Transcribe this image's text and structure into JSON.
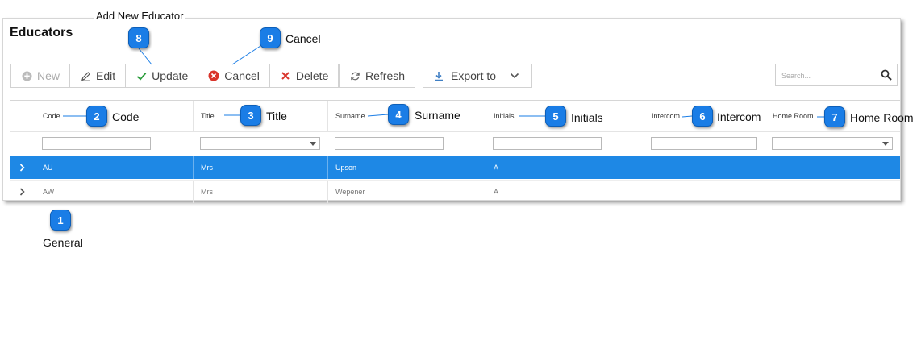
{
  "panel": {
    "title": "Educators"
  },
  "toolbar": {
    "new_label": "New",
    "edit_label": "Edit",
    "update_label": "Update",
    "cancel_label": "Cancel",
    "delete_label": "Delete",
    "refresh_label": "Refresh",
    "export_label": "Export to"
  },
  "search": {
    "placeholder": "Search..."
  },
  "grid": {
    "columns": [
      "Code",
      "Title",
      "Surname",
      "Initials",
      "Intercom",
      "Home Room"
    ],
    "rows": [
      {
        "code": "AU",
        "title": "Mrs",
        "surname": "Upson",
        "initials": "A",
        "intercom": "",
        "home_room": "",
        "selected": true
      },
      {
        "code": "AW",
        "title": "Mrs",
        "surname": "Wepener",
        "initials": "A",
        "intercom": "",
        "home_room": "",
        "selected": false
      }
    ]
  },
  "callouts": [
    {
      "number": "1",
      "label": "General"
    },
    {
      "number": "2",
      "label": "Code"
    },
    {
      "number": "3",
      "label": "Title"
    },
    {
      "number": "4",
      "label": "Surname"
    },
    {
      "number": "5",
      "label": "Initials"
    },
    {
      "number": "6",
      "label": "Intercom"
    },
    {
      "number": "7",
      "label": "Home Room"
    },
    {
      "number": "8",
      "label": "Add New Educator"
    },
    {
      "number": "9",
      "label": "Cancel"
    }
  ],
  "colors": {
    "accent": "#1e88e5",
    "callout": "#1a7de6",
    "success": "#2e9e3e",
    "danger": "#d9342b"
  },
  "icons": {
    "new": "plus-circle-icon",
    "edit": "pencil-icon",
    "update": "check-icon",
    "cancel": "x-circle-icon",
    "delete": "x-icon",
    "refresh": "refresh-icon",
    "export": "download-icon",
    "search": "magnifier-icon",
    "expand": "chevron-right-icon"
  }
}
